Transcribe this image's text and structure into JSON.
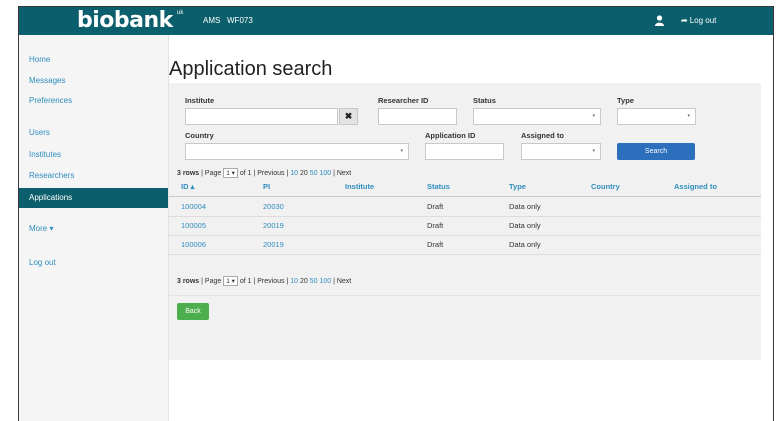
{
  "app": {
    "logo_text": "biobank",
    "logo_sup": "uk",
    "nav": [
      "AMS",
      "WF073"
    ],
    "logout_label": "Log out"
  },
  "sidebar": {
    "items": [
      "Home",
      "Messages",
      "Preferences",
      "Users",
      "Institutes",
      "Researchers",
      "Applications",
      "More ▾",
      "Log out"
    ],
    "active": "Applications"
  },
  "page": {
    "title": "Application search"
  },
  "filters": {
    "institute_label": "Institute",
    "researcher_id_label": "Researcher ID",
    "status_label": "Status",
    "type_label": "Type",
    "country_label": "Country",
    "application_id_label": "Application ID",
    "assigned_to_label": "Assigned to",
    "clear_symbol": "✖",
    "search_label": "Search",
    "caret": "▾"
  },
  "pager": {
    "rows": "3 rows",
    "page_label": "| Page",
    "page_value": "1 ▾",
    "of_label": "of 1 | Previous |",
    "sizes": [
      "10",
      "20",
      "50",
      "100"
    ],
    "next_label": "| Next"
  },
  "table": {
    "columns": [
      "ID ▴",
      "PI",
      "Institute",
      "Status",
      "Type",
      "Country",
      "Assigned to"
    ],
    "rows": [
      {
        "id": "100004",
        "pi": "20030",
        "institute": "",
        "status": "Draft",
        "type": "Data only",
        "country": "",
        "assigned": ""
      },
      {
        "id": "100005",
        "pi": "20019",
        "institute": "",
        "status": "Draft",
        "type": "Data only",
        "country": "",
        "assigned": ""
      },
      {
        "id": "100006",
        "pi": "20019",
        "institute": "",
        "status": "Draft",
        "type": "Data only",
        "country": "",
        "assigned": ""
      }
    ]
  },
  "actions": {
    "back_label": "Back"
  },
  "colors": {
    "brand": "#0b5e6b",
    "link": "#2f8dbf",
    "primary_button": "#2c6fbd",
    "success_button": "#4cae4c"
  }
}
